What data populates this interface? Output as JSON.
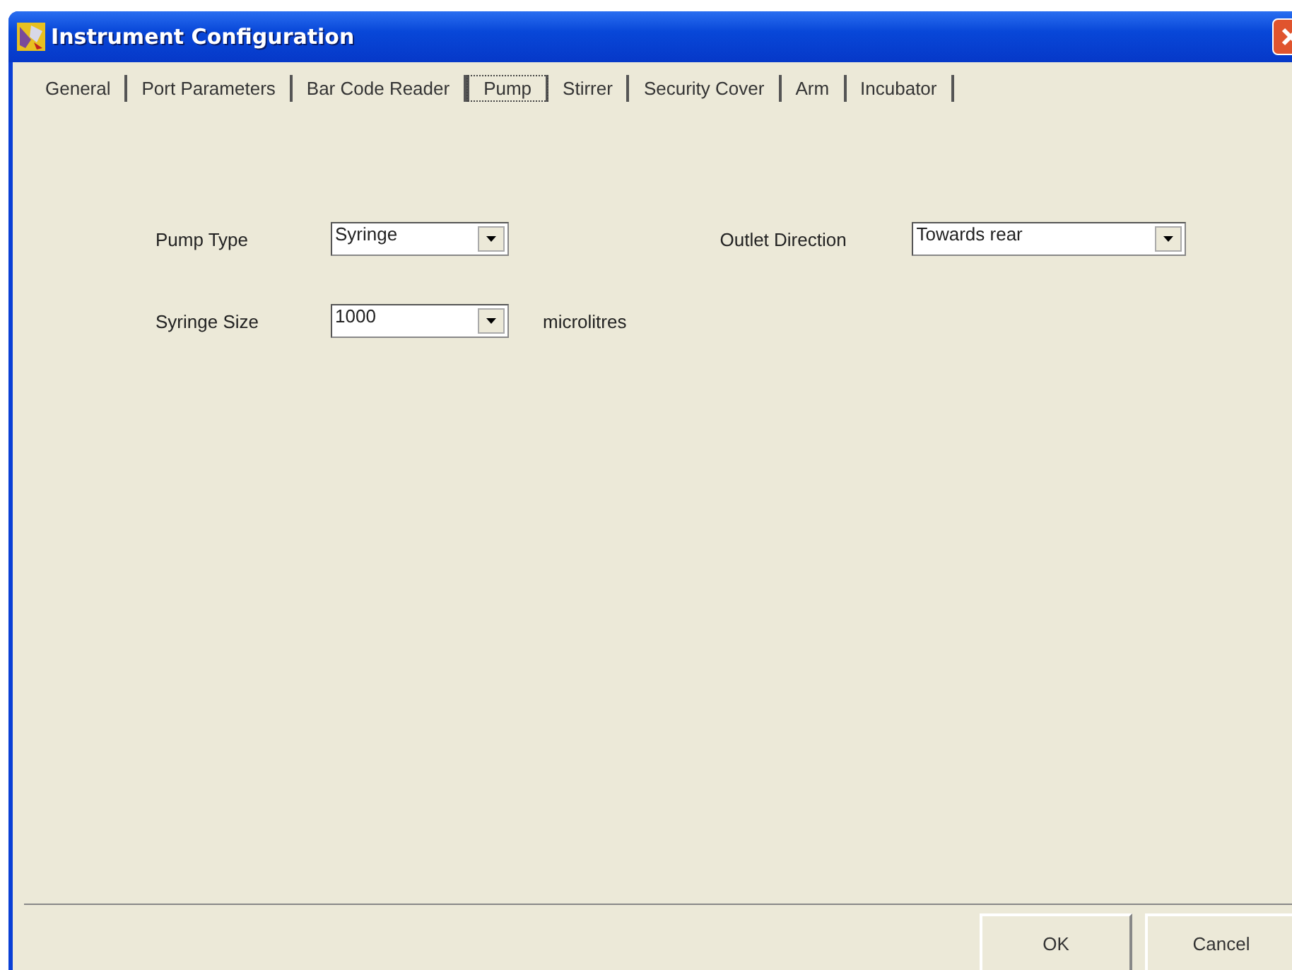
{
  "window": {
    "title": "Instrument Configuration"
  },
  "tabs": [
    {
      "label": "General",
      "selected": false
    },
    {
      "label": "Port Parameters",
      "selected": false
    },
    {
      "label": "Bar Code Reader",
      "selected": false
    },
    {
      "label": "Pump",
      "selected": true
    },
    {
      "label": "Stirrer",
      "selected": false
    },
    {
      "label": "Security Cover",
      "selected": false
    },
    {
      "label": "Arm",
      "selected": false
    },
    {
      "label": "Incubator",
      "selected": false
    }
  ],
  "pump_type": {
    "label": "Pump Type",
    "value": "Syringe"
  },
  "syringe_size": {
    "label": "Syringe Size",
    "value": "1000",
    "unit": "microlitres"
  },
  "outlet_direction": {
    "label": "Outlet Direction",
    "value": "Towards rear"
  },
  "buttons": [
    "OK",
    "Cancel"
  ]
}
